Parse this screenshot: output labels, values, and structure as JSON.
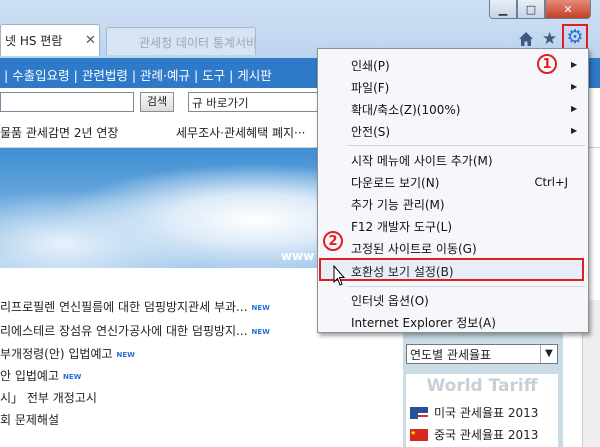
{
  "window": {
    "min_label": "▁",
    "max_label": "□",
    "close_label": "✕"
  },
  "tabs": [
    {
      "label": "넷 HS 편람",
      "close": "✕"
    },
    {
      "label": "관세청 데이터 통계서비스"
    }
  ],
  "toolbar": {
    "home_icon": "home-icon",
    "star_label": "★",
    "gear_label": "⚙"
  },
  "nav": {
    "text": "| 수출입요령 | 관련법령 | 관례·예규 | 도구 | 게시판"
  },
  "search": {
    "button": "검색",
    "quick_select": "규 바로가기"
  },
  "news": {
    "left": "물품 관세감면 2년 연장",
    "right": "세무조사·관세혜택 폐지···"
  },
  "banner": {
    "url_text": "www"
  },
  "notices": [
    {
      "text": "리프로필렌 연신필름에 대한 덤핑방지관세 부과...",
      "new": "NEW"
    },
    {
      "text": "리에스테르 장섬유 연신가공사에 대한 덤핑방지...",
      "new": "NEW"
    },
    {
      "text": "부개정령(안) 입법예고",
      "new": "NEW"
    },
    {
      "text": "안 입법예고",
      "new": "NEW"
    },
    {
      "text": "시」 전부 개정고시",
      "new": ""
    },
    {
      "text": "회 문제해설",
      "new": ""
    }
  ],
  "sidebar": {
    "year_select": "연도별 관세율표",
    "world_tariff": "World Tariff",
    "tariffs": [
      {
        "label": "미국 관세율표 2013",
        "flag": "us-flag"
      },
      {
        "label": "중국 관세율표 2013",
        "flag": "cn-flag"
      }
    ]
  },
  "menu": {
    "items": [
      {
        "label": "인쇄(P)",
        "submenu": true
      },
      {
        "label": "파일(F)",
        "submenu": true
      },
      {
        "label": "확대/축소(Z)(100%)",
        "submenu": true
      },
      {
        "label": "안전(S)",
        "submenu": true
      },
      {
        "label": "시작 메뉴에 사이트 추가(M)"
      },
      {
        "label": "다운로드 보기(N)",
        "shortcut": "Ctrl+J"
      },
      {
        "label": "추가 기능 관리(M)"
      },
      {
        "label": "F12 개발자 도구(L)"
      },
      {
        "label": "고정된 사이트로 이동(G)"
      },
      {
        "label": "호환성 보기 설정(B)",
        "highlighted": true
      },
      {
        "label": "인터넷 옵션(O)"
      },
      {
        "label": "Internet Explorer 정보(A)"
      }
    ]
  },
  "annotations": {
    "step1": "1",
    "step2": "2",
    "color": "#e02020"
  }
}
